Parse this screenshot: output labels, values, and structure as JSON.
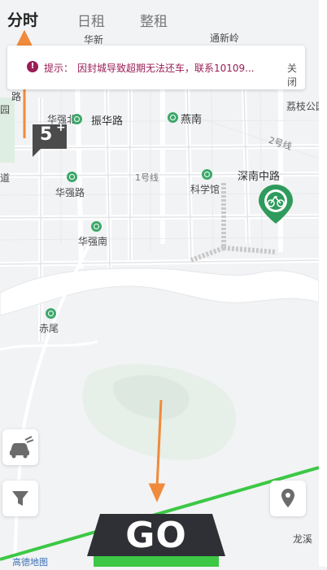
{
  "tabs": [
    {
      "label": "分时",
      "active": true
    },
    {
      "label": "日租",
      "active": false
    },
    {
      "label": "整租",
      "active": false
    }
  ],
  "notice": {
    "icon": "!",
    "tag": "提示：",
    "text": "因封城导致超期无法还车，联系10109...",
    "close": "关闭"
  },
  "map": {
    "labels": {
      "huaxin": "华新",
      "tongxinling": "通新岭",
      "huaqiangbei": "华强北",
      "zhenhualu": "振华路",
      "yannan": "燕南",
      "lizhiyuan": "荔枝公园",
      "line2": "2号线",
      "shennanzhonglu": "深南中路",
      "line1": "1号线",
      "huaqianglu": "华强路",
      "kexueguan": "科学馆",
      "huaqiangnan": "华强南",
      "chiwei": "赤尾",
      "longxi": "龙溪",
      "dao": "道",
      "yuan": "园",
      "lu": "路"
    }
  },
  "car_count": {
    "number": "5",
    "plus": "+"
  },
  "go_button": {
    "label": "GO"
  },
  "footer": {
    "logo_text": "高德地图"
  },
  "colors": {
    "accent_green": "#3cc845",
    "notice": "#9a1c55",
    "marker_green": "#2e9b5c",
    "arrow": "#f08a3c"
  },
  "icons": [
    "car-speed-icon",
    "filter-icon",
    "location-pin-icon",
    "bike-marker-icon",
    "alert-icon"
  ]
}
